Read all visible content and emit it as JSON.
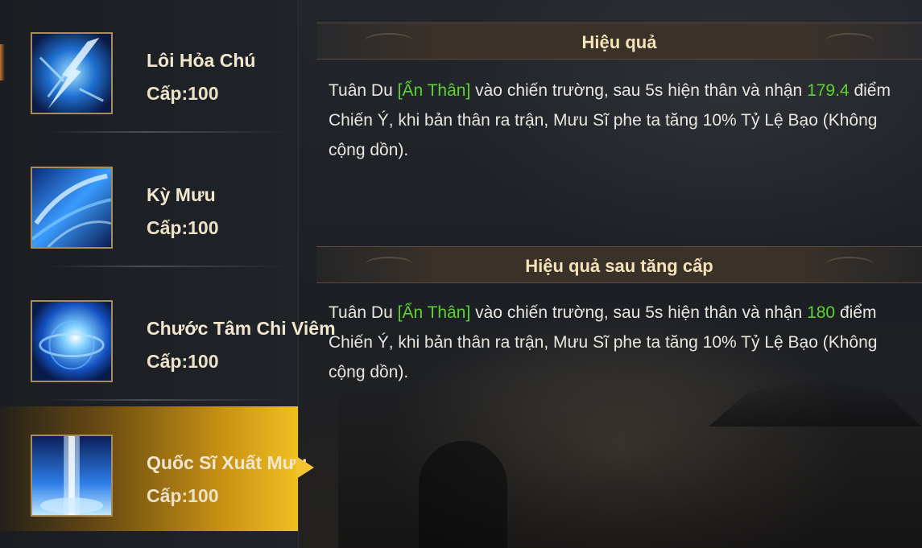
{
  "skills": [
    {
      "name": "Lôi Hỏa Chú",
      "level": "Cấp:100",
      "icon": "lightning-fire-skill-icon",
      "selected": false
    },
    {
      "name": "Kỳ Mưu",
      "level": "Cấp:100",
      "icon": "blue-swirl-skill-icon",
      "selected": false
    },
    {
      "name": "Chước Tâm Chi Viêm",
      "level": "Cấp:100",
      "icon": "blue-burst-skill-icon",
      "selected": false
    },
    {
      "name": "Quốc Sĩ Xuất Mưu",
      "level": "Cấp:100",
      "icon": "light-pillar-skill-icon",
      "selected": true
    }
  ],
  "effect": {
    "title": "Hiệu quả",
    "text_1": "Tuân Du ",
    "tag": "[Ẩn Thân]",
    "text_2": " vào chiến trường, sau 5s hiện thân và nhận ",
    "value": "179.4",
    "text_3": " điểm Chiến Ý, khi bản thân ra trận, Mưu Sĩ phe ta tăng 10% Tỷ Lệ Bạo (Không cộng dồn)."
  },
  "upgrade_effect": {
    "title": "Hiệu quả sau tăng cấp",
    "text_1": "Tuân Du ",
    "tag": "[Ẩn Thân]",
    "text_2": " vào chiến trường, sau 5s hiện thân và nhận ",
    "value": "180",
    "text_3": " điểm Chiến Ý, khi bản thân ra trận, Mưu Sĩ phe ta tăng 10% Tỷ Lệ Bạo (Không cộng dồn)."
  },
  "colors": {
    "highlight": "#5fd233",
    "selected_gold": "#f0c022",
    "header_text": "#f4e3b8"
  }
}
